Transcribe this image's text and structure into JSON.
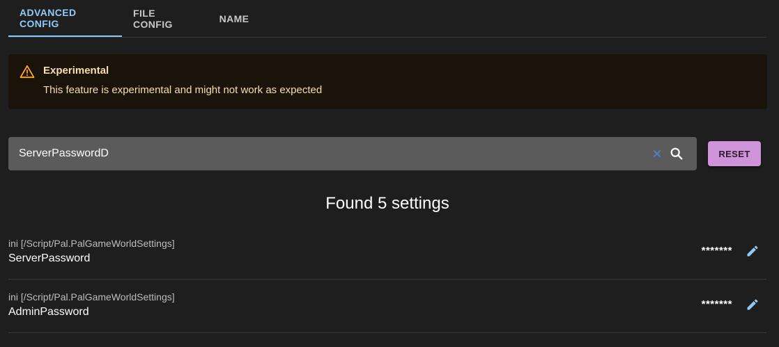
{
  "tabs": [
    {
      "label": "ADVANCED CONFIG",
      "active": true
    },
    {
      "label": "FILE CONFIG",
      "active": false
    },
    {
      "label": "NAME",
      "active": false
    }
  ],
  "alert": {
    "icon": "warning-icon",
    "title": "Experimental",
    "message": "This feature is experimental and might not work as expected",
    "color": "#f8dfb0",
    "icon_color": "#ffa726"
  },
  "search": {
    "value": "ServerPasswordD",
    "clear_icon": "close-icon",
    "search_icon": "search-icon"
  },
  "reset": {
    "label": "RESET",
    "color": "#ce93d8"
  },
  "results": {
    "heading": "Found 5 settings"
  },
  "settings": [
    {
      "path": "ini [/Script/Pal.PalGameWorldSettings]",
      "name": "ServerPassword",
      "value": "*******",
      "edit_icon": "pencil-icon"
    },
    {
      "path": "ini [/Script/Pal.PalGameWorldSettings]",
      "name": "AdminPassword",
      "value": "*******",
      "edit_icon": "pencil-icon"
    }
  ],
  "theme": {
    "background": "#1e1e1e",
    "accent": "#90caf9"
  }
}
